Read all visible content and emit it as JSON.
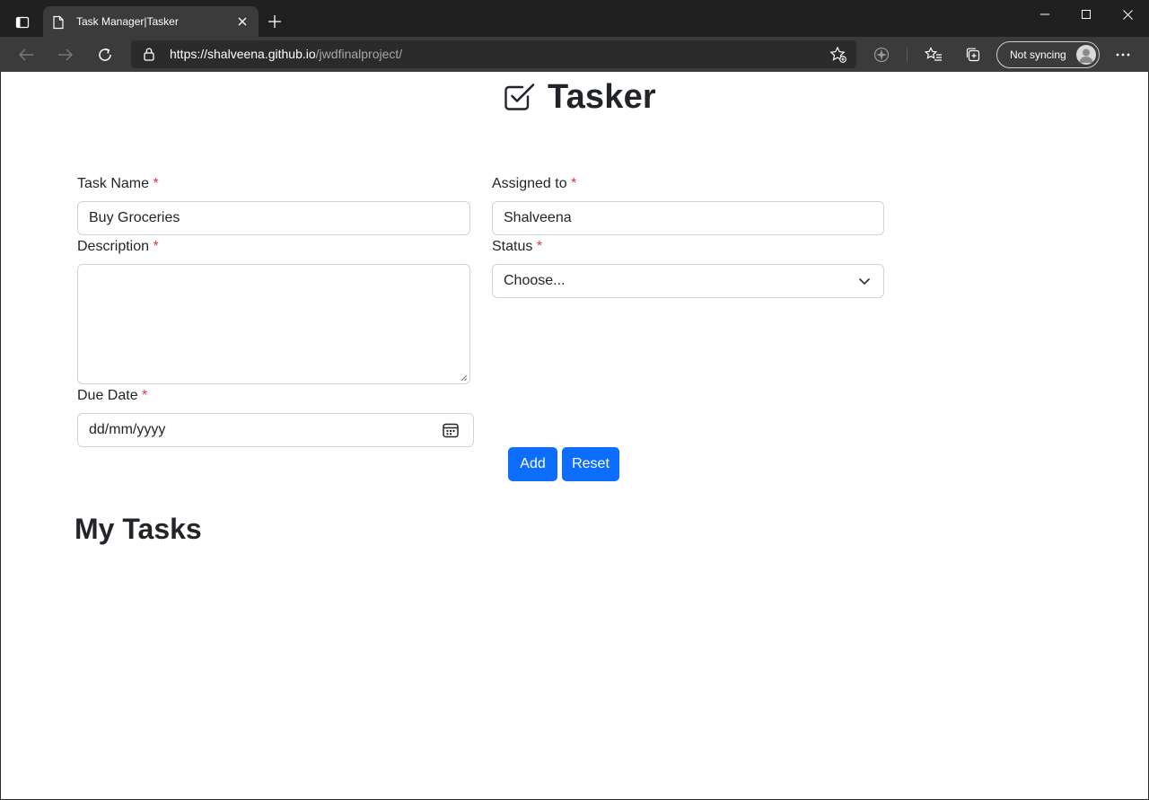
{
  "browser": {
    "tab_title": "Task Manager|Tasker",
    "url_host": "https://shalveena.github.io",
    "url_path": "/jwdfinalproject/",
    "profile_label": "Not syncing"
  },
  "app": {
    "title": "Tasker",
    "icon": "check-square-icon"
  },
  "form": {
    "task_name": {
      "label": "Task Name",
      "required_mark": "*",
      "value": "Buy Groceries"
    },
    "assigned_to": {
      "label": "Assigned to",
      "required_mark": "*",
      "value": "Shalveena"
    },
    "description": {
      "label": "Description",
      "required_mark": "*",
      "value": ""
    },
    "status": {
      "label": "Status",
      "required_mark": "*",
      "selected": "Choose..."
    },
    "due_date": {
      "label": "Due Date",
      "required_mark": "*",
      "placeholder": "dd/mm/yyyy"
    },
    "add_label": "Add",
    "reset_label": "Reset"
  },
  "tasks": {
    "heading": "My Tasks"
  },
  "colors": {
    "primary": "#0d6efd",
    "required": "#dc3545",
    "text": "#212529",
    "border": "#ced4da"
  }
}
